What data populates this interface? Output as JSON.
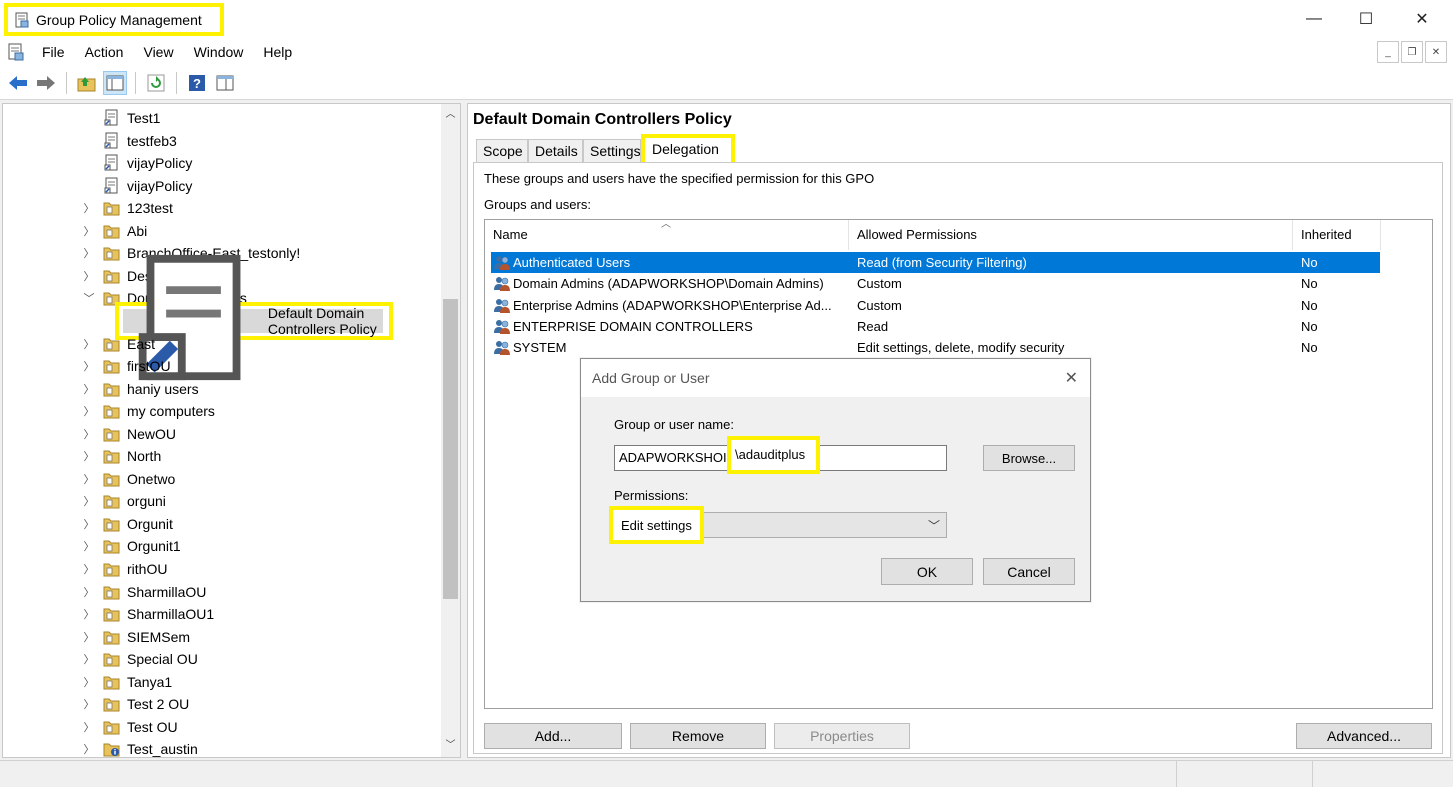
{
  "window": {
    "title": "Group Policy Management",
    "minimize": "—",
    "maximize": "☐",
    "close": "✕"
  },
  "menu": [
    "File",
    "Action",
    "View",
    "Window",
    "Help"
  ],
  "mdi": {
    "min": "_",
    "restore": "❐",
    "close": "✕"
  },
  "toolbar": [
    "back-icon",
    "forward-icon",
    "up-folder-icon",
    "show-hide-tree-icon",
    "refresh-icon",
    "help-icon",
    "properties-icon"
  ],
  "tree": {
    "items": [
      {
        "label": "Test1",
        "type": "gpo",
        "expand": false
      },
      {
        "label": "testfeb3",
        "type": "gpo",
        "expand": false
      },
      {
        "label": "vijayPolicy",
        "type": "gpo",
        "expand": false
      },
      {
        "label": "vijayPolicy",
        "type": "gpo",
        "expand": false
      },
      {
        "label": "123test",
        "type": "ou",
        "expand": true
      },
      {
        "label": "Abi",
        "type": "ou",
        "expand": true
      },
      {
        "label": "BranchOffice-East_testonly!",
        "type": "ou",
        "expand": true
      },
      {
        "label": "Design_Test",
        "type": "ou",
        "expand": true
      },
      {
        "label": "Domain Controllers",
        "type": "ou",
        "expand": "open"
      },
      {
        "label": "Default Domain Controllers Policy",
        "type": "gpo-selected",
        "expand": false
      },
      {
        "label": "East",
        "type": "ou",
        "expand": true
      },
      {
        "label": "firstOU",
        "type": "ou",
        "expand": true
      },
      {
        "label": "haniy users",
        "type": "ou",
        "expand": true
      },
      {
        "label": "my computers",
        "type": "ou",
        "expand": true
      },
      {
        "label": "NewOU",
        "type": "ou",
        "expand": true
      },
      {
        "label": "North",
        "type": "ou",
        "expand": true
      },
      {
        "label": "Onetwo",
        "type": "ou",
        "expand": true
      },
      {
        "label": "orguni",
        "type": "ou",
        "expand": true
      },
      {
        "label": "Orgunit",
        "type": "ou",
        "expand": true
      },
      {
        "label": "Orgunit1",
        "type": "ou",
        "expand": true
      },
      {
        "label": "rithOU",
        "type": "ou",
        "expand": true
      },
      {
        "label": "SharmillaOU",
        "type": "ou",
        "expand": true
      },
      {
        "label": "SharmillaOU1",
        "type": "ou",
        "expand": true
      },
      {
        "label": "SIEMSem",
        "type": "ou",
        "expand": true
      },
      {
        "label": "Special OU",
        "type": "ou",
        "expand": true
      },
      {
        "label": "Tanya1",
        "type": "ou",
        "expand": true
      },
      {
        "label": "Test 2 OU",
        "type": "ou",
        "expand": true
      },
      {
        "label": "Test OU",
        "type": "ou",
        "expand": true
      },
      {
        "label": "Test_austin",
        "type": "ou-info",
        "expand": true
      }
    ]
  },
  "gpo": {
    "title": "Default Domain Controllers Policy",
    "tabs": [
      "Scope",
      "Details",
      "Settings",
      "Delegation"
    ],
    "active_tab": "Delegation",
    "description": "These groups and users have the specified permission for this GPO",
    "groups_label": "Groups and users:",
    "columns": [
      "Name",
      "Allowed Permissions",
      "Inherited"
    ],
    "rows": [
      {
        "name": "Authenticated Users",
        "permission": "Read (from Security Filtering)",
        "inherited": "No",
        "selected": true
      },
      {
        "name": "Domain Admins (ADAPWORKSHOP\\Domain Admins)",
        "permission": "Custom",
        "inherited": "No"
      },
      {
        "name": "Enterprise Admins (ADAPWORKSHOP\\Enterprise Ad...",
        "permission": "Custom",
        "inherited": "No"
      },
      {
        "name": "ENTERPRISE DOMAIN CONTROLLERS",
        "permission": "Read",
        "inherited": "No"
      },
      {
        "name": "SYSTEM",
        "permission": "Edit settings, delete, modify security",
        "inherited": "No"
      }
    ],
    "buttons": {
      "add": "Add...",
      "remove": "Remove",
      "properties": "Properties",
      "advanced": "Advanced..."
    }
  },
  "dialog": {
    "title": "Add Group or User",
    "name_label": "Group or user name:",
    "name_prefix": "ADAPWORKSHOI",
    "name_value": "\\adauditplus",
    "browse": "Browse...",
    "permissions_label": "Permissions:",
    "permission_value": "Edit settings",
    "ok": "OK",
    "cancel": "Cancel"
  },
  "colors": {
    "highlight": "#fff200",
    "selection": "#0078d7",
    "folder": "#e8c25a"
  }
}
